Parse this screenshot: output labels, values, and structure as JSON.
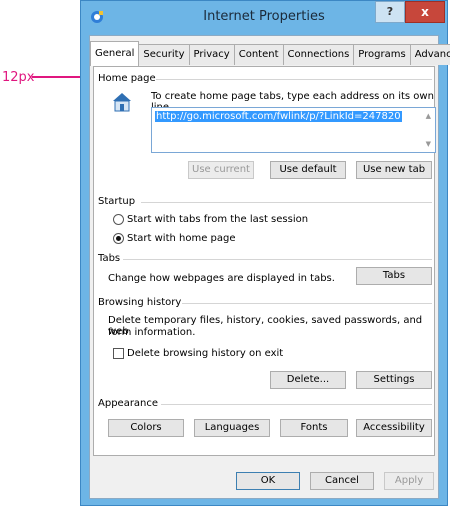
{
  "annotation": {
    "label": "12px"
  },
  "window": {
    "title": "Internet Properties",
    "help_glyph": "?",
    "close_glyph": "x"
  },
  "tabs": [
    {
      "label": "General",
      "active": true
    },
    {
      "label": "Security"
    },
    {
      "label": "Privacy"
    },
    {
      "label": "Content"
    },
    {
      "label": "Connections"
    },
    {
      "label": "Programs"
    },
    {
      "label": "Advanced"
    }
  ],
  "home_page": {
    "section_label": "Home page",
    "instruction": "To create home page tabs, type each address on its own line.",
    "url": "http://go.microsoft.com/fwlink/p/?LinkId=247820",
    "buttons": {
      "use_current": "Use current",
      "use_default": "Use default",
      "use_new_tab": "Use new tab"
    }
  },
  "startup": {
    "section_label": "Startup",
    "option_tabs": "Start with tabs from the last session",
    "option_home": "Start with home page",
    "selected": "home"
  },
  "tabs_section": {
    "section_label": "Tabs",
    "description": "Change how webpages are displayed in tabs.",
    "button": "Tabs"
  },
  "browsing_history": {
    "section_label": "Browsing history",
    "description_line1": "Delete temporary files, history, cookies, saved passwords, and web",
    "description_line2": "form information.",
    "checkbox_label": "Delete browsing history on exit",
    "checkbox_checked": false,
    "delete_button": "Delete...",
    "settings_button": "Settings"
  },
  "appearance": {
    "section_label": "Appearance",
    "colors": "Colors",
    "languages": "Languages",
    "fonts": "Fonts",
    "accessibility": "Accessibility"
  },
  "footer": {
    "ok": "OK",
    "cancel": "Cancel",
    "apply": "Apply"
  }
}
